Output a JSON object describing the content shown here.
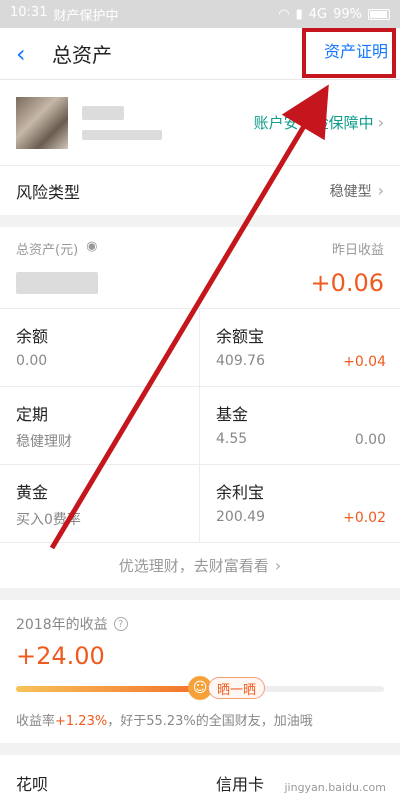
{
  "status_bar": {
    "time": "10:31",
    "app_label": "财产保护中",
    "network": "4G",
    "battery": "99%"
  },
  "nav": {
    "title": "总资产",
    "cert_link": "资产证明"
  },
  "account": {
    "safety_text": "账户安全险保障中"
  },
  "risk": {
    "label": "风险类型",
    "value": "稳健型"
  },
  "assets": {
    "total_label": "总资产(元)",
    "yesterday_label": "昨日收益",
    "yesterday_value": "+0.06"
  },
  "grid": [
    {
      "name": "余额",
      "sub": "0.00",
      "delta": ""
    },
    {
      "name": "余额宝",
      "sub": "409.76",
      "delta": "+0.04"
    },
    {
      "name": "定期",
      "sub": "稳健理财",
      "delta": ""
    },
    {
      "name": "基金",
      "sub": "4.55",
      "delta": "0.00"
    },
    {
      "name": "黄金",
      "sub": "买入0费率",
      "delta": ""
    },
    {
      "name": "余利宝",
      "sub": "200.49",
      "delta": "+0.02"
    }
  ],
  "promo": "优选理财，去财富看看",
  "earnings": {
    "title": "2018年的收益",
    "amount": "+24.00",
    "share_label": "晒一晒",
    "progress": 0.5,
    "note_prefix": "收益率",
    "rate": "+1.23%",
    "note_suffix": "，好于55.23%的全国财友，加油哦"
  },
  "bottom": {
    "left": "花呗",
    "right": "信用卡"
  },
  "watermark": "jingyan.baidu.com",
  "colors": {
    "accent": "#1677ff",
    "profit": "#ef5b1f",
    "highlight": "#c4161c",
    "safe": "#0f9d8b"
  }
}
